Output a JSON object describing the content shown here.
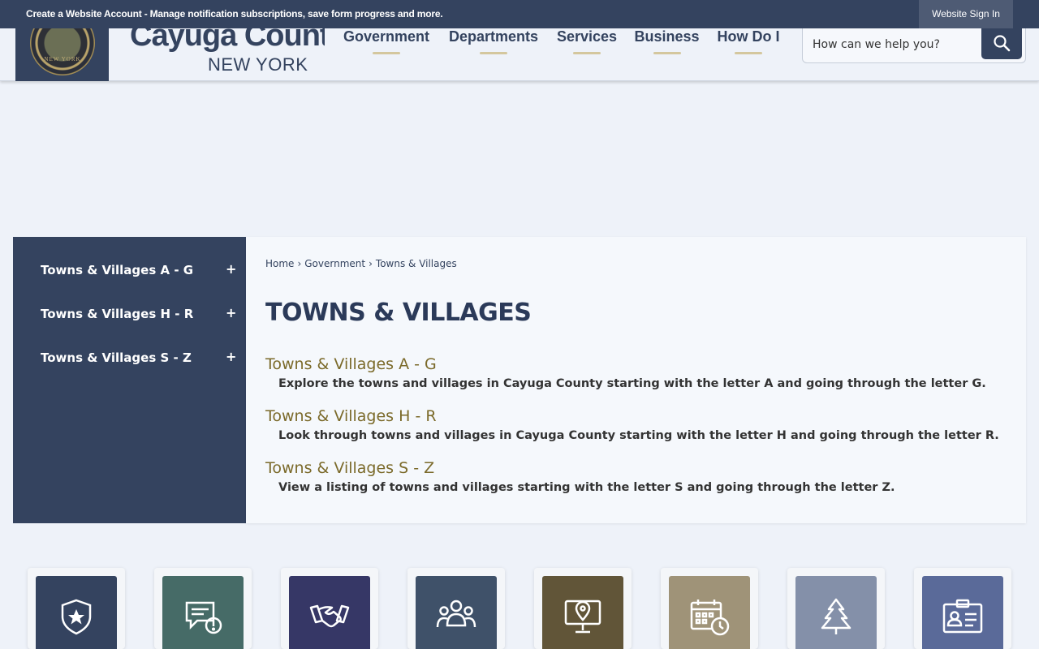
{
  "topbar": {
    "message": "Create a Website Account - Manage notification subscriptions, save form progress and more.",
    "signin_label": "Website Sign In"
  },
  "header": {
    "brand_name": "Cayuga County",
    "brand_state": "NEW YORK",
    "seal_icon": "county-seal-icon",
    "seal_text": "NEW YORK",
    "nav": [
      {
        "label": "Government"
      },
      {
        "label": "Departments"
      },
      {
        "label": "Services"
      },
      {
        "label": "Business"
      },
      {
        "label": "How Do I"
      }
    ],
    "search": {
      "placeholder": "How can we help you?",
      "button_icon": "search-icon"
    }
  },
  "sidenav": {
    "items": [
      {
        "label": "Towns & Villages A - G",
        "expand": "+"
      },
      {
        "label": "Towns & Villages H - R",
        "expand": "+"
      },
      {
        "label": "Towns & Villages S - Z",
        "expand": "+"
      }
    ]
  },
  "main": {
    "breadcrumb": [
      {
        "label": "Home"
      },
      {
        "label": "Government"
      },
      {
        "label": "Towns & Villages"
      }
    ],
    "breadcrumb_separator": "›",
    "title": "TOWNS & VILLAGES",
    "entries": [
      {
        "title": "Towns & Villages A - G",
        "description": "Explore the towns and villages in Cayuga County starting with the letter A and going through the letter G."
      },
      {
        "title": "Towns & Villages H - R",
        "description": "Look through towns and villages in Cayuga County starting with the letter H and going through the letter R."
      },
      {
        "title": "Towns & Villages S - Z",
        "description": "View a listing of towns and villages starting with the letter S and going through the letter Z."
      }
    ]
  },
  "quick_links": [
    {
      "icon": "shield-star-icon",
      "color": "#34435f"
    },
    {
      "icon": "chat-alert-icon",
      "color": "#466b67"
    },
    {
      "icon": "handshake-icon",
      "color": "#363766"
    },
    {
      "icon": "people-group-icon",
      "color": "#3f5169"
    },
    {
      "icon": "monitor-location-icon",
      "color": "#615538"
    },
    {
      "icon": "calendar-clock-icon",
      "color": "#9f9378"
    },
    {
      "icon": "pine-tree-icon",
      "color": "#8490a9"
    },
    {
      "icon": "id-card-icon",
      "color": "#5a6a99"
    }
  ],
  "colors": {
    "primary": "#34435f",
    "accent_gold": "#7b6a2a",
    "nav_underline": "#d4c79e",
    "page_background": "#eef2f9"
  }
}
